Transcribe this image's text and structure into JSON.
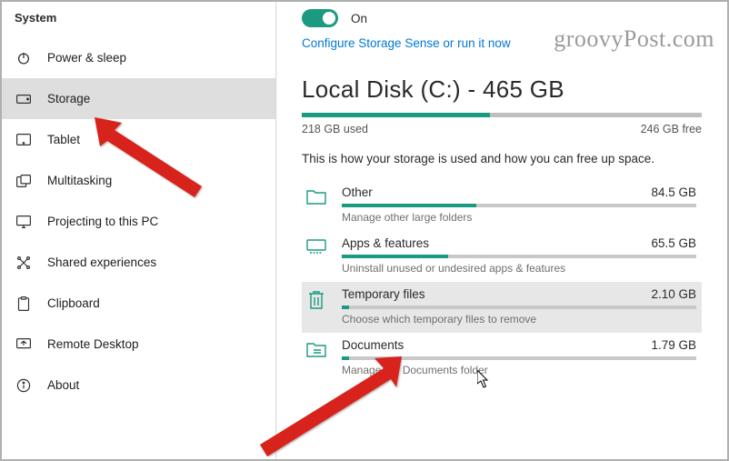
{
  "watermark": "groovyPost.com",
  "sidebar": {
    "header": "System",
    "items": [
      {
        "label": "Power & sleep"
      },
      {
        "label": "Storage"
      },
      {
        "label": "Tablet"
      },
      {
        "label": "Multitasking"
      },
      {
        "label": "Projecting to this PC"
      },
      {
        "label": "Shared experiences"
      },
      {
        "label": "Clipboard"
      },
      {
        "label": "Remote Desktop"
      },
      {
        "label": "About"
      }
    ],
    "selected_index": 1
  },
  "storage": {
    "toggle_state": "On",
    "config_link": "Configure Storage Sense or run it now",
    "disk_title": "Local Disk (C:) - 465 GB",
    "used_label": "218 GB used",
    "free_label": "246 GB free",
    "used_pct": 47,
    "explain": "This is how your storage is used and how you can free up space.",
    "categories": [
      {
        "name": "Other",
        "size": "84.5 GB",
        "sub": "Manage other large folders",
        "pct": 38
      },
      {
        "name": "Apps & features",
        "size": "65.5 GB",
        "sub": "Uninstall unused or undesired apps & features",
        "pct": 30
      },
      {
        "name": "Temporary files",
        "size": "2.10 GB",
        "sub": "Choose which temporary files to remove",
        "pct": 2
      },
      {
        "name": "Documents",
        "size": "1.79 GB",
        "sub": "Manage the Documents folder",
        "pct": 2
      }
    ],
    "hover_index": 2
  }
}
